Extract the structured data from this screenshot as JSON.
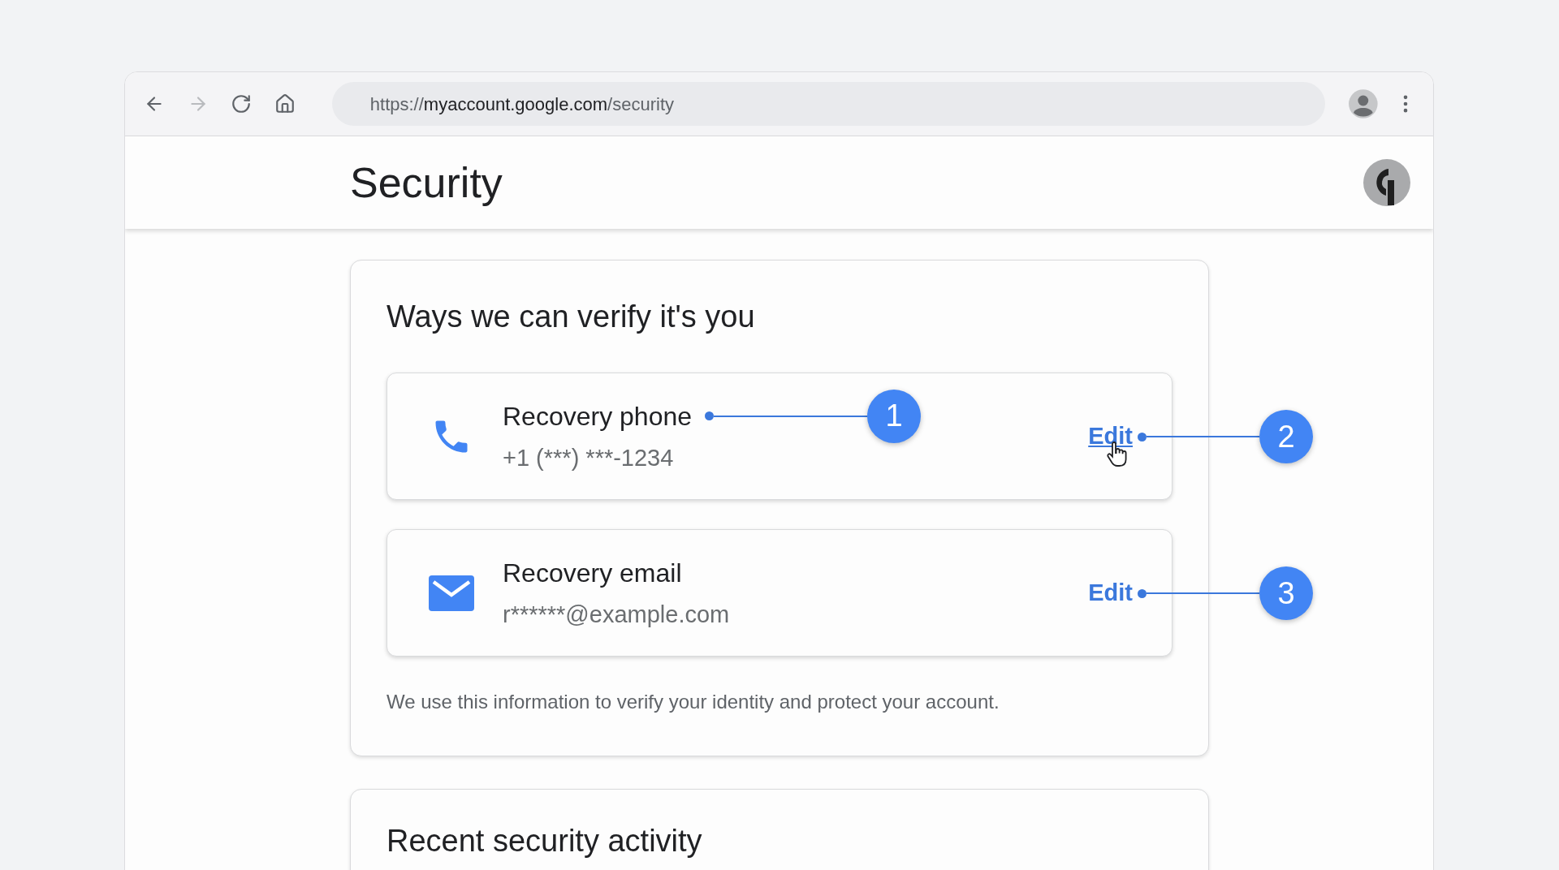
{
  "browser": {
    "toolbar": [
      {
        "kind": "back",
        "disabled": false
      },
      {
        "kind": "forward",
        "disabled": true
      },
      {
        "kind": "reload",
        "disabled": false
      },
      {
        "kind": "home",
        "disabled": false
      }
    ],
    "url": {
      "scheme": "https://",
      "host": "myaccount.google.com",
      "path": "/security"
    }
  },
  "page": {
    "title": "Security"
  },
  "verify_card": {
    "title": "Ways we can verify it's you",
    "methods": [
      {
        "kind": "phone",
        "label": "Recovery phone",
        "value": "+1 (***) ***-1234",
        "action": "Edit",
        "hovered": true,
        "label_callout": "1",
        "action_callout": "2"
      },
      {
        "kind": "email",
        "label": "Recovery email",
        "value": "r******@example.com",
        "action": "Edit",
        "hovered": false,
        "action_callout": "3"
      }
    ],
    "note": "We use this information to verify your identity and protect your account."
  },
  "activity_card": {
    "title": "Recent security activity"
  }
}
